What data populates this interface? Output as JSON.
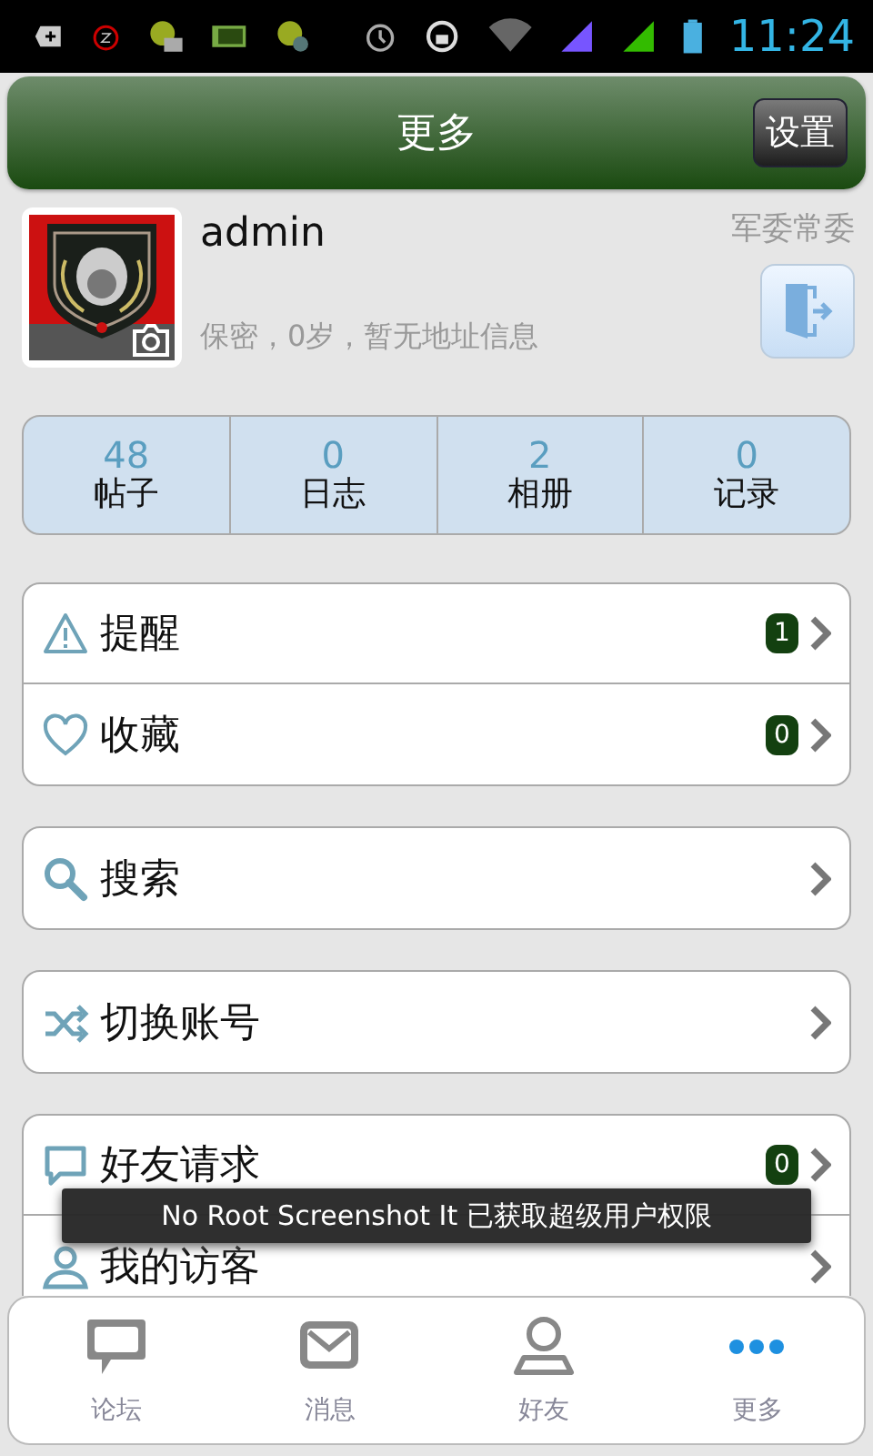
{
  "status_bar": {
    "time": "11:24"
  },
  "header": {
    "title": "更多",
    "settings_button": "设置"
  },
  "profile": {
    "username": "admin",
    "rank": "军委常委",
    "info": "保密，0岁，暂无地址信息"
  },
  "stats": [
    {
      "value": "48",
      "label": "帖子"
    },
    {
      "value": "0",
      "label": "日志"
    },
    {
      "value": "2",
      "label": "相册"
    },
    {
      "value": "0",
      "label": "记录"
    }
  ],
  "menu_groups": [
    {
      "items": [
        {
          "label": "提醒",
          "badge": "1"
        },
        {
          "label": "收藏",
          "badge": "0"
        }
      ]
    },
    {
      "items": [
        {
          "label": "搜索"
        }
      ]
    },
    {
      "items": [
        {
          "label": "切换账号"
        }
      ]
    },
    {
      "items": [
        {
          "label": "好友请求",
          "badge": "0"
        },
        {
          "label": "我的访客"
        }
      ]
    }
  ],
  "toast": "No Root Screenshot It 已获取超级用户权限",
  "tab_bar": [
    {
      "label": "论坛",
      "selected": false
    },
    {
      "label": "消息",
      "selected": false
    },
    {
      "label": "好友",
      "selected": false
    },
    {
      "label": "更多",
      "selected": true
    }
  ]
}
